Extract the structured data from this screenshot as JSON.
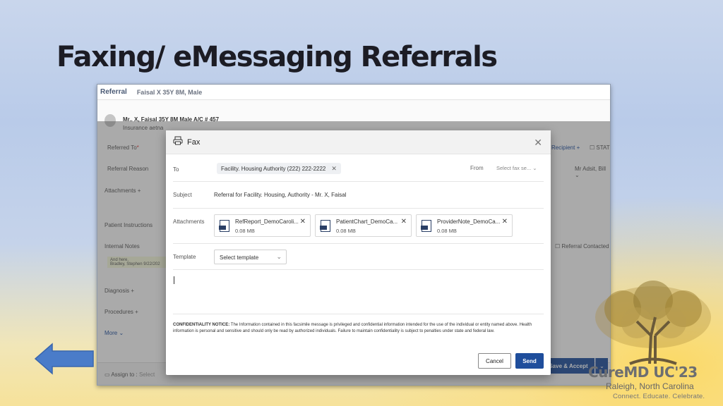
{
  "slide": {
    "title": "Faxing/ eMessaging Referrals",
    "brand": "CureMD UC'23",
    "location": "Raleigh, North Carolina",
    "tagline": "Connect. Educate. Celebrate."
  },
  "app": {
    "section": "Referral",
    "patient_summary": "Faisal X 35Y 8M, Male",
    "patient_line1": "Mr.. X, Faisal  35Y 8M Male  A/C # 457",
    "patient_line2": "Insurance aetna",
    "fields": {
      "referred_to": "Referred To",
      "referred_to_required": "*",
      "referral_reason": "Referral Reason",
      "attachments": "Attachments",
      "patient_instructions": "Patient Instructions",
      "internal_notes": "Internal Notes",
      "internal_note_text": "And here.",
      "internal_note_author": "Bradley, Stephen 9/22/202",
      "diagnosis": "Diagnosis",
      "procedures": "Procedures",
      "more": "More",
      "assign_to": "Assign to :",
      "assign_select": "Select",
      "recipient": "Recipient",
      "stat": "STAT",
      "provider": "Mr Adsit, Bill",
      "referral_contacted": "Referral Contacted"
    },
    "save_accept": "Save & Accept"
  },
  "modal": {
    "title": "Fax",
    "to_label": "To",
    "to_chip": "Facility. Housing Authority (222) 222-2222",
    "from_label": "From",
    "from_placeholder": "Select fax se...",
    "subject_label": "Subject",
    "subject_value": "Referral for Facility. Housing, Authority  - Mr. X, Faisal",
    "attachments_label": "Attachments",
    "attachments": [
      {
        "name": "RefReport_DemoCaroli...",
        "size": "0.08 MB"
      },
      {
        "name": "PatientChart_DemoCa...",
        "size": "0.08 MB"
      },
      {
        "name": "ProviderNote_DemoCa...",
        "size": "0.08 MB"
      }
    ],
    "template_label": "Template",
    "template_placeholder": "Select template",
    "confidentiality_heading": "CONFIDENTIALITY NOTICE:",
    "confidentiality_text": "The Information contained in this facsimile message is privileged and confidential information intended for the use of the individual or entity named above. Health information is personal and sensitive and should only be read by authorized individuals. Failure to maintain confidentiality is subject to penalties under state and federal law.",
    "cancel_label": "Cancel",
    "send_label": "Send"
  },
  "colors": {
    "primary_button": "#1f4e9c",
    "arrow": "#4a7cc9"
  }
}
